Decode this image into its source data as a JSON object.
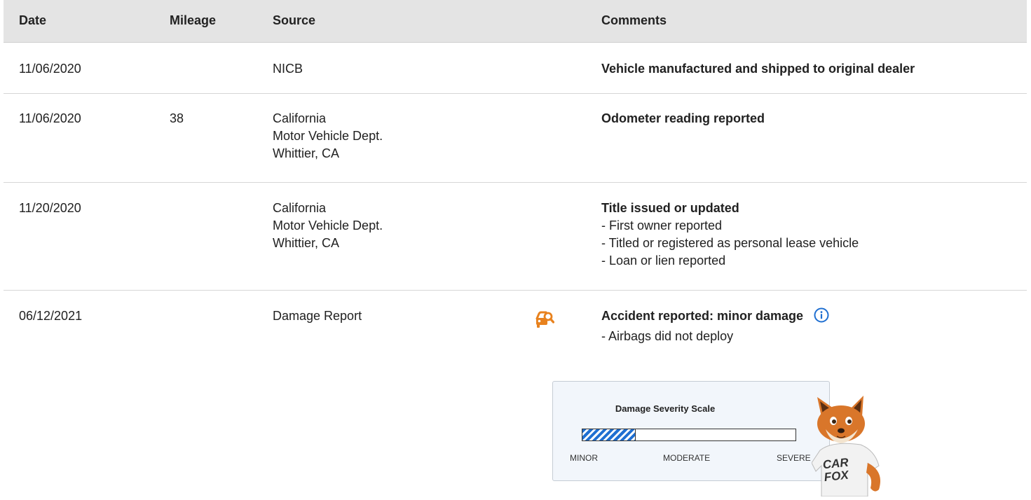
{
  "header": {
    "date": "Date",
    "mileage": "Mileage",
    "source": "Source",
    "comments": "Comments"
  },
  "rows": [
    {
      "date": "11/06/2020",
      "mileage": "",
      "source": [
        "NICB"
      ],
      "comment_title": "Vehicle manufactured and shipped to original dealer",
      "comment_details": []
    },
    {
      "date": "11/06/2020",
      "mileage": "38",
      "source": [
        "California",
        "Motor Vehicle Dept.",
        "Whittier, CA"
      ],
      "comment_title": "Odometer reading reported",
      "comment_details": []
    },
    {
      "date": "11/20/2020",
      "mileage": "",
      "source": [
        "California",
        "Motor Vehicle Dept.",
        "Whittier, CA"
      ],
      "comment_title": "Title issued or updated",
      "comment_details": [
        "- First owner reported",
        "- Titled or registered as personal lease vehicle",
        "- Loan or lien reported"
      ]
    },
    {
      "date": "06/12/2021",
      "mileage": "",
      "source": [
        "Damage Report"
      ],
      "icon": "damage-search-icon",
      "comment_title": "Accident reported: minor damage",
      "comment_details": [
        "- Airbags did not deploy"
      ],
      "info_icon": "info-icon"
    }
  ],
  "severity_scale": {
    "title": "Damage Severity Scale",
    "labels": [
      "MINOR",
      "MODERATE",
      "SEVERE"
    ],
    "level_fraction": 0.25,
    "fill_color": "#1f6fd1"
  },
  "mascot": {
    "name": "carfox-mascot",
    "shirt_text": [
      "CAR",
      "FOX"
    ]
  },
  "colors": {
    "header_bg": "#e4e4e4",
    "damage_icon": "#e8821e",
    "info_icon": "#1f6fd1"
  }
}
